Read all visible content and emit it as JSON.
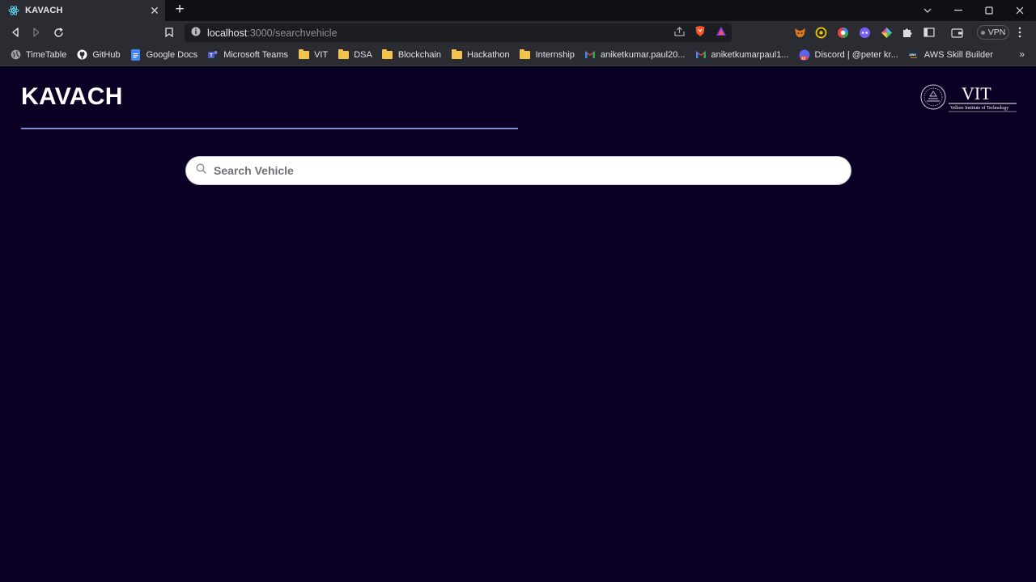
{
  "browser": {
    "tab_title": "KAVACH",
    "url_host": "localhost",
    "url_rest": ":3000/searchvehicle",
    "vpn_label": "VPN",
    "bookmarks": [
      {
        "label": "TimeTable",
        "icon": "globe-icon"
      },
      {
        "label": "GitHub",
        "icon": "github-icon"
      },
      {
        "label": "Google Docs",
        "icon": "docs-icon"
      },
      {
        "label": "Microsoft Teams",
        "icon": "teams-icon"
      },
      {
        "label": "VIT",
        "icon": "folder-icon"
      },
      {
        "label": "DSA",
        "icon": "folder-icon"
      },
      {
        "label": "Blockchain",
        "icon": "folder-icon"
      },
      {
        "label": "Hackathon",
        "icon": "folder-icon"
      },
      {
        "label": "Internship",
        "icon": "folder-icon"
      },
      {
        "label": "aniketkumar.paul20...",
        "icon": "gmail-icon"
      },
      {
        "label": "aniketkumarpaul1...",
        "icon": "gmail-icon"
      },
      {
        "label": "Discord | @peter kr...",
        "icon": "discord-icon"
      },
      {
        "label": "AWS Skill Builder",
        "icon": "aws-icon"
      }
    ]
  },
  "page": {
    "title": "KAVACH",
    "logo_text": "VIT",
    "logo_subtext": "Vellore Institute of Technology",
    "search_placeholder": "Search Vehicle"
  },
  "colors": {
    "page_bg": "#0b0024",
    "title_rule": "#7e8fd6",
    "search_bg": "#ffffff"
  }
}
